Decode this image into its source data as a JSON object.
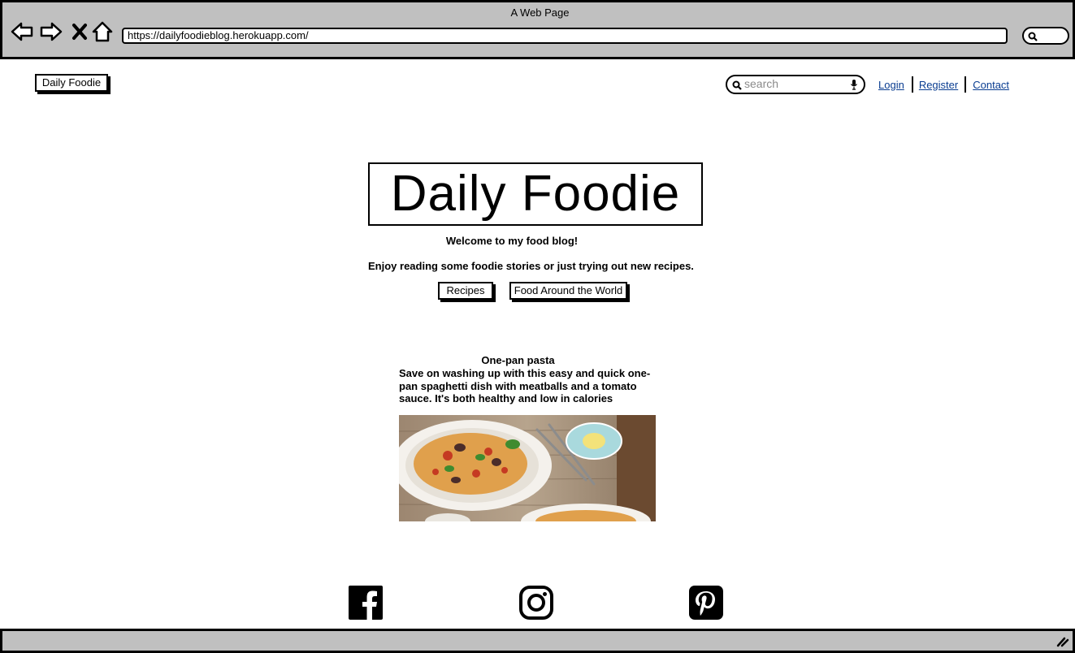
{
  "browser": {
    "window_title": "A Web Page",
    "url": "https://dailyfoodieblog.herokuapp.com/"
  },
  "header": {
    "brand_label": "Daily Foodie",
    "search_placeholder": "search",
    "nav": [
      {
        "label": "Login"
      },
      {
        "label": "Register"
      },
      {
        "label": "Contact"
      }
    ]
  },
  "hero": {
    "title": "Daily Foodie",
    "subtitle": "Welcome to my food blog!",
    "tagline": "Enjoy reading some foodie stories or just trying out new recipes.",
    "buttons": [
      {
        "label": "Recipes"
      },
      {
        "label": "Food Around the World"
      }
    ]
  },
  "article": {
    "title": "One-pan pasta",
    "text": "Save on washing up with this easy and quick one-pan spaghetti dish with meatballs and a tomato sauce. It's both healthy and low in calories"
  },
  "footer": {
    "social": [
      "facebook-icon",
      "instagram-icon",
      "pinterest-icon"
    ]
  },
  "colors": {
    "chrome": "#c0c0c0",
    "link": "#0a3d91"
  }
}
